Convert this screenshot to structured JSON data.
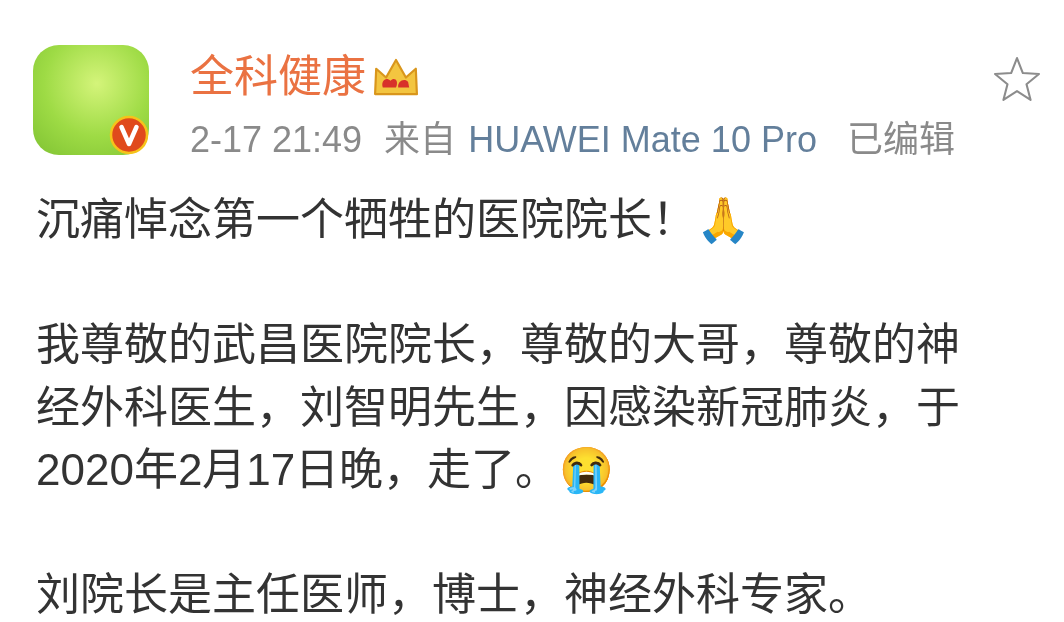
{
  "post": {
    "author": {
      "name": "全科健康",
      "verified": true,
      "vip": true
    },
    "meta": {
      "time": "2-17 21:49",
      "source_label": "来自",
      "source": "HUAWEI Mate 10 Pro",
      "edited_label": "已编辑"
    },
    "favorited": false,
    "paragraphs": [
      {
        "text": "沉痛悼念第一个牺牲的医院院长！🙏"
      },
      {
        "text": "我尊敬的武昌医院院长，尊敬的大哥，尊敬的神经外科医生，刘智明先生，因感染新冠肺炎，于2020年2月17日晚，走了。😭"
      },
      {
        "text": "刘院长是主任医师，博士，神经外科专家。"
      }
    ]
  }
}
